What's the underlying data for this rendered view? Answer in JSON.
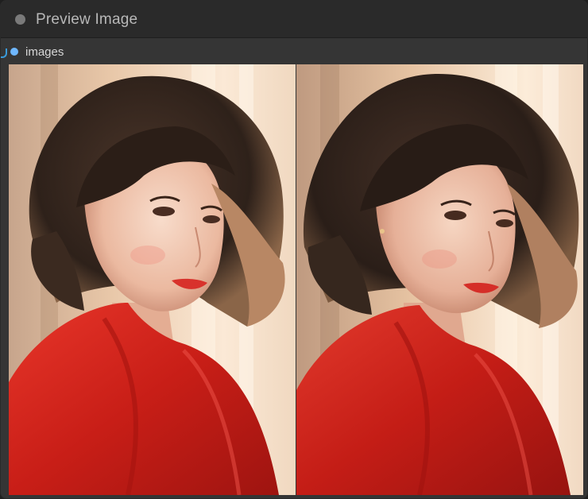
{
  "node": {
    "title": "Preview Image",
    "input_label": "images"
  },
  "colors": {
    "header_bg": "#2a2a2a",
    "body_bg": "#353535",
    "input_dot": "#6fb7ff",
    "wire": "#3a9ad9",
    "dress_red": "#d8241c",
    "backlight": "#fbe6cf",
    "hair": "#3a2a22"
  },
  "previews": [
    {
      "icon": "portrait-image"
    },
    {
      "icon": "portrait-image"
    }
  ]
}
